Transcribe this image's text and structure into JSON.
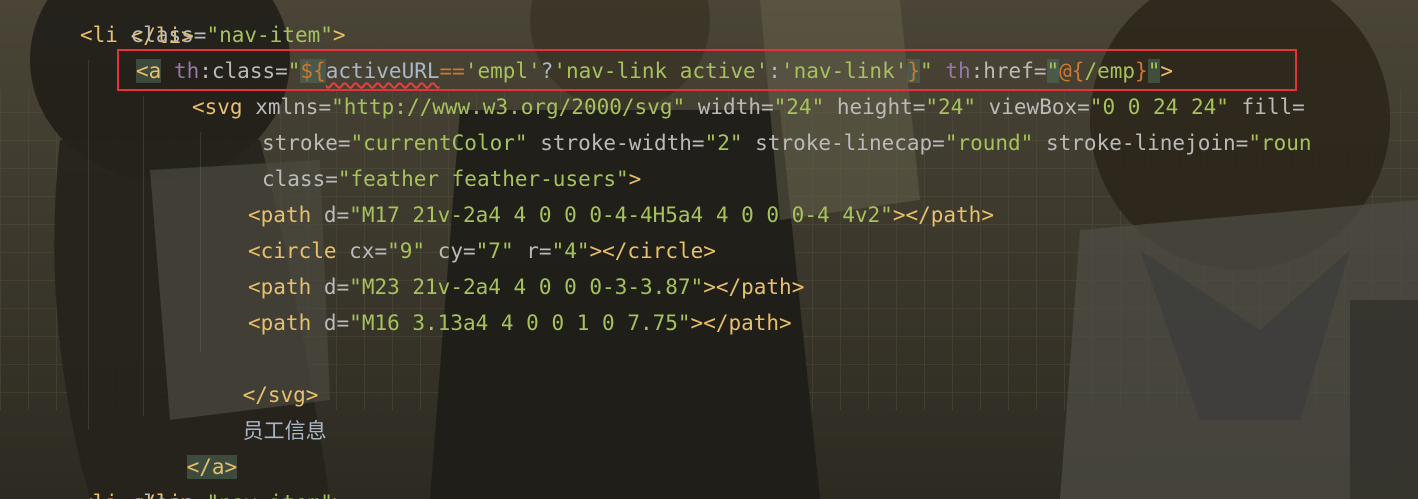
{
  "editor": {
    "lines": {
      "l0": {
        "tag": "</li>"
      },
      "l1": {
        "open": "<li ",
        "attr": "class",
        "eq": "=",
        "val": "\"nav-item\"",
        "close": ">"
      },
      "l2": {
        "open": "<a",
        "ns1": "th",
        "attr1": ":class",
        "eq1": "=",
        "q1": "\"",
        "exOpen": "${",
        "var": "activeURL",
        "op": "==",
        "s1": "'empl'",
        "qm": "?",
        "s2": "'nav-link active'",
        "colon": ":",
        "s3": "'nav-link'",
        "exClose": "}",
        "q2": "\"",
        "ns2": "th",
        "attr2": ":href",
        "eq2": "=",
        "q3": "\"",
        "urlOpen": "@{",
        "urlVal": "/emp",
        "urlClose": "}",
        "q4": "\"",
        "close": ">"
      },
      "l3": {
        "open": "<svg ",
        "a1": "xmlns",
        "v1": "\"http://www.w3.org/2000/svg\"",
        "a2": "width",
        "v2": "\"24\"",
        "a3": "height",
        "v3": "\"24\"",
        "a4": "viewBox",
        "v4": "\"0 0 24 24\"",
        "a5": "fill="
      },
      "l4": {
        "a1": "stroke",
        "v1": "\"currentColor\"",
        "a2": "stroke-width",
        "v2": "\"2\"",
        "a3": "stroke-linecap",
        "v3": "\"round\"",
        "a4": "stroke-linejoin",
        "v4": "\"roun"
      },
      "l5": {
        "a1": "class",
        "v1": "\"feather feather-users\"",
        "close": ">"
      },
      "l6": {
        "open": "<path ",
        "a1": "d",
        "v1": "\"M17 21v-2a4 4 0 0 0-4-4H5a4 4 0 0 0-4 4v2\"",
        "close": "></path>"
      },
      "l7": {
        "open": "<circle ",
        "a1": "cx",
        "v1": "\"9\"",
        "a2": "cy",
        "v2": "\"7\"",
        "a3": "r",
        "v3": "\"4\"",
        "close": "></circle>"
      },
      "l8": {
        "open": "<path ",
        "a1": "d",
        "v1": "\"M23 21v-2a4 4 0 0 0-3-3.87\"",
        "close": "></path>"
      },
      "l9": {
        "open": "<path ",
        "a1": "d",
        "v1": "\"M16 3.13a4 4 0 0 1 0 7.75\"",
        "close": "></path>"
      },
      "l10": {
        "tag": "</svg>"
      },
      "l11": {
        "text": "员工信息"
      },
      "l12": {
        "tag": "</a>"
      },
      "l13": {
        "tag": "</li>"
      },
      "l14": {
        "open": "<li ",
        "attr": "class",
        "eq": "=",
        "val": "\"nav-item\"",
        "close": ">"
      }
    }
  },
  "colors": {
    "tag": "#e8bf6a",
    "attribute": "#bababa",
    "namespace": "#9876aa",
    "string": "#a5c25c",
    "expression": "#cc7832",
    "highlight_box": "#e8323a"
  }
}
